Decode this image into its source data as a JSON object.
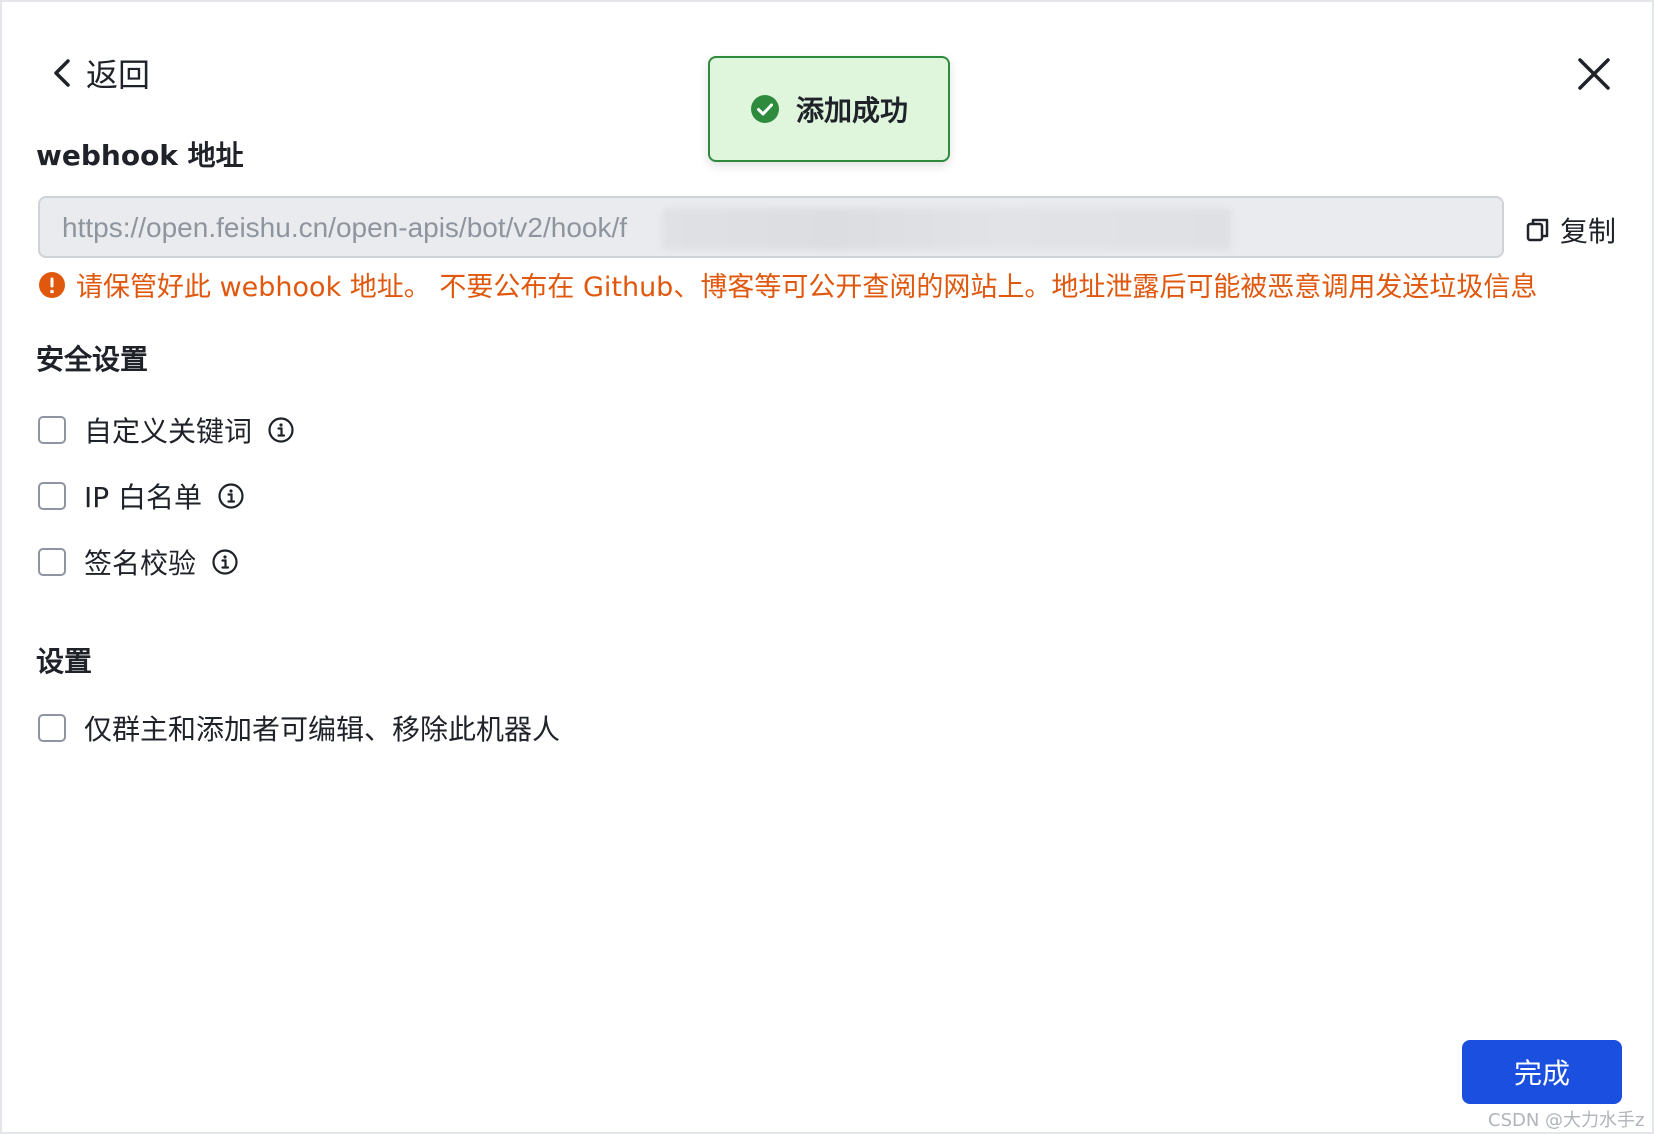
{
  "header": {
    "back_label": "返回",
    "back_icon": "chevron-left-icon",
    "close_icon": "close-icon"
  },
  "toast": {
    "text": "添加成功",
    "icon": "check-circle-icon",
    "color": "#2e8b3e"
  },
  "webhook": {
    "label": "webhook 地址",
    "url_visible": "https://open.feishu.cn/open-apis/bot/v2/hook/f",
    "copy_label": "复制",
    "copy_icon": "copy-icon",
    "warning_icon": "warning-circle-icon",
    "warning_text": "请保管好此 webhook 地址。 不要公布在 Github、博客等可公开查阅的网站上。地址泄露后可能被恶意调用发送垃圾信息",
    "warning_color": "#e0580e"
  },
  "security": {
    "title": "安全设置",
    "options": [
      {
        "label": "自定义关键词",
        "checked": false,
        "info_icon": "info-icon"
      },
      {
        "label": "IP 白名单",
        "checked": false,
        "info_icon": "info-icon"
      },
      {
        "label": "签名校验",
        "checked": false,
        "info_icon": "info-icon"
      }
    ]
  },
  "settings": {
    "title": "设置",
    "options": [
      {
        "label": "仅群主和添加者可编辑、移除此机器人",
        "checked": false
      }
    ]
  },
  "footer": {
    "done_label": "完成",
    "accent_color": "#1a4fe0"
  },
  "watermark": "CSDN @大力水手z"
}
